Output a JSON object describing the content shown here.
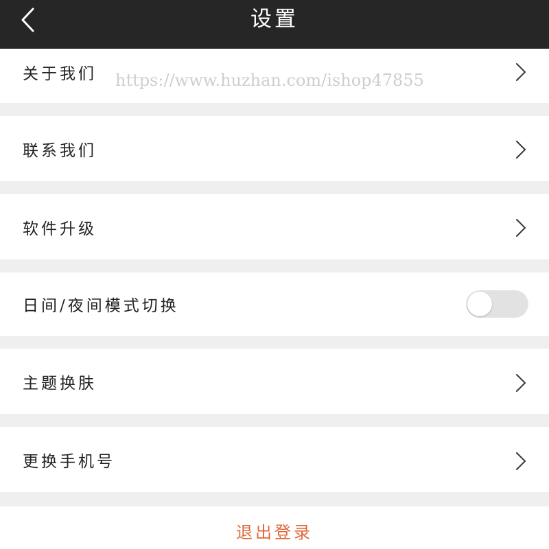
{
  "header": {
    "title": "设置",
    "back_icon": "chevron-left-icon"
  },
  "watermark": "https://www.huzhan.com/ishop47855",
  "settings": {
    "items": [
      {
        "label": "关于我们",
        "type": "link"
      },
      {
        "label": "联系我们",
        "type": "link"
      },
      {
        "label": "软件升级",
        "type": "link"
      },
      {
        "label": "日间/夜间模式切换",
        "type": "toggle",
        "enabled": false
      },
      {
        "label": "主题换肤",
        "type": "link"
      },
      {
        "label": "更换手机号",
        "type": "link"
      }
    ]
  },
  "logout": {
    "label": "退出登录",
    "color": "#e0673a"
  },
  "colors": {
    "header_bg": "#262626",
    "page_bg": "#efefef",
    "row_bg": "#ffffff",
    "toggle_off": "#e2e2e2"
  }
}
